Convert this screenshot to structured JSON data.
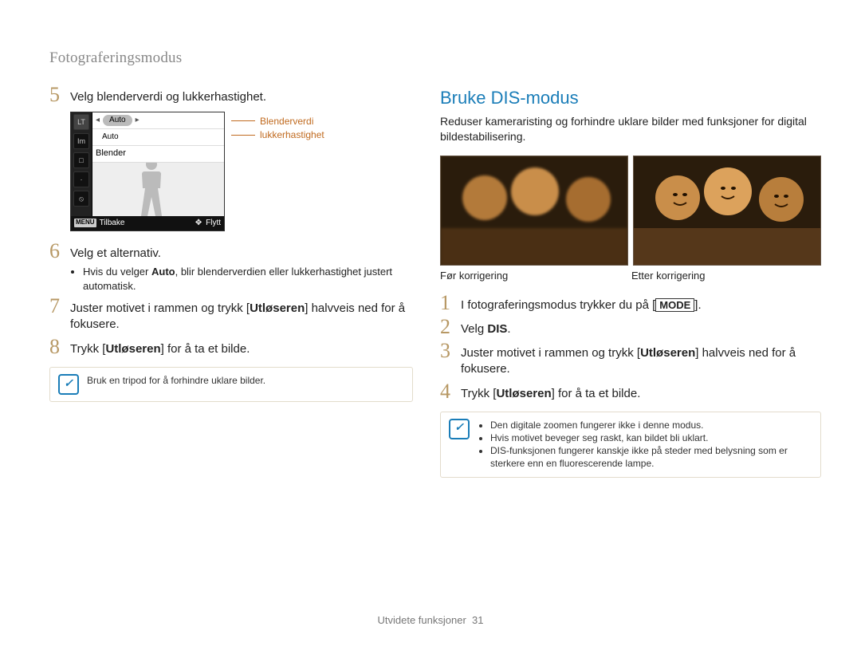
{
  "breadcrumb": "Fotograferingsmodus",
  "footer_label": "Utvidete funksjoner",
  "footer_page": "31",
  "left": {
    "steps": [
      {
        "num": "5",
        "text": "Velg blenderverdi og lukkerhastighet."
      },
      {
        "num": "6",
        "text": "Velg et alternativ.",
        "sub_before": "Hvis du velger ",
        "sub_bold": "Auto",
        "sub_after": ", blir blenderverdien eller lukkerhastighet justert automatisk."
      },
      {
        "num": "7",
        "before": "Juster motivet i rammen og trykk [",
        "bold": "Utløseren",
        "after": "] halvveis ned for å fokusere."
      },
      {
        "num": "8",
        "before": "Trykk [",
        "bold": "Utløseren",
        "after": "] for å ta et bilde."
      }
    ],
    "tip": "Bruk en tripod for å forhindre uklare bilder."
  },
  "lcd": {
    "side": {
      "lt": "LT",
      "im": "Im",
      "i3": "□",
      "i4": "·",
      "i5": "⦸"
    },
    "row1_auto": "Auto",
    "row2_auto": "Auto",
    "row3_label": "Blender",
    "back_tag": "MENU",
    "back": "Tilbake",
    "move_icon": "✥",
    "move": "Flytt",
    "annot1": "Blenderverdi",
    "annot2": "lukkerhastighet"
  },
  "right": {
    "title": "Bruke DIS-modus",
    "intro": "Reduser kameraristing og forhindre uklare bilder med funksjoner for digital bildestabilisering.",
    "cap_before": "Før korrigering",
    "cap_after": "Etter korrigering",
    "steps": [
      {
        "num": "1",
        "before": "I fotograferingsmodus trykker du på [",
        "mode": "MODE",
        "after": "]."
      },
      {
        "num": "2",
        "before": "Velg ",
        "bold": "DIS",
        "after": "."
      },
      {
        "num": "3",
        "before": "Juster motivet i rammen og trykk [",
        "bold": "Utløseren",
        "after": "] halvveis ned for å fokusere."
      },
      {
        "num": "4",
        "before": "Trykk [",
        "bold": "Utløseren",
        "after": "] for å ta et bilde."
      }
    ],
    "notes": [
      "Den digitale zoomen fungerer ikke i denne modus.",
      "Hvis motivet beveger seg raskt, kan bildet bli uklart.",
      "DIS-funksjonen fungerer kanskje ikke på steder med belysning som er sterkere enn en fluorescerende lampe."
    ]
  }
}
